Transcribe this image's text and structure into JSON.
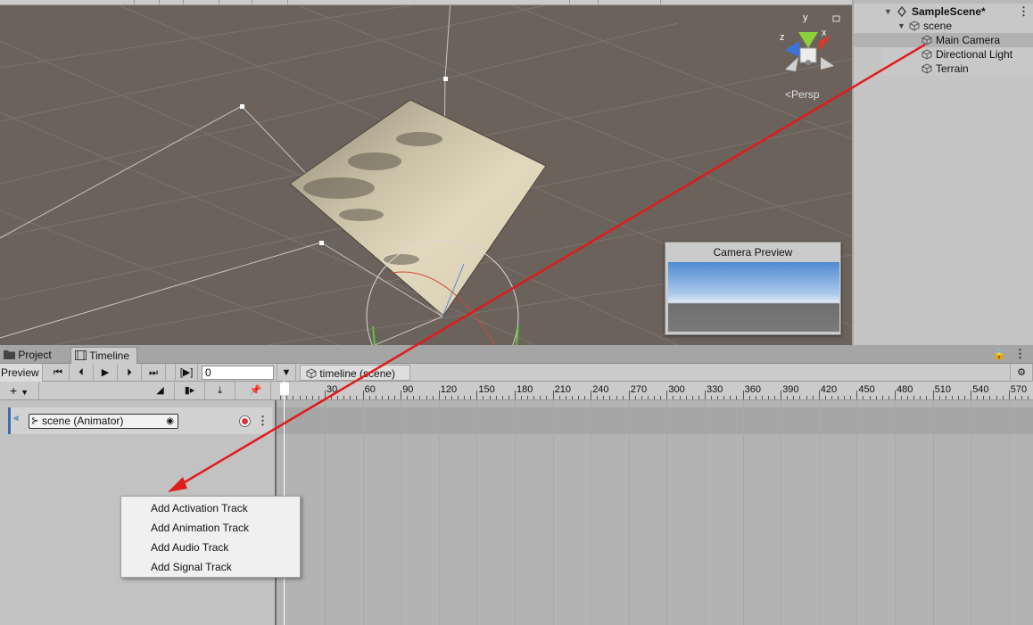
{
  "scene_view": {
    "persp_label": "Persp",
    "gizmo_axes": {
      "x": "x",
      "y": "y",
      "z": "z"
    },
    "camera_preview_title": "Camera Preview"
  },
  "hierarchy": {
    "scene_name": "SampleScene*",
    "items": [
      {
        "label": "scene"
      },
      {
        "label": "Main Camera"
      },
      {
        "label": "Directional Light"
      },
      {
        "label": "Terrain"
      }
    ]
  },
  "timeline_window": {
    "tabs": [
      {
        "label": "Project"
      },
      {
        "label": "Timeline"
      }
    ],
    "preview_label": "Preview",
    "frame_value": "0",
    "breadcrumb": "timeline (scene)",
    "ruler_ticks": [
      "30",
      "60",
      "90",
      "120",
      "150",
      "180",
      "210",
      "240",
      "270",
      "300",
      "330",
      "360",
      "390",
      "420",
      "450",
      "480",
      "510",
      "540",
      "570"
    ],
    "track": {
      "label": "scene (Animator)"
    }
  },
  "context_menu": {
    "items": [
      {
        "label": "Add Activation Track"
      },
      {
        "label": "Add Animation Track"
      },
      {
        "label": "Add Audio Track"
      },
      {
        "label": "Add Signal Track"
      }
    ]
  },
  "colors": {
    "annotation_arrow": "#e01b1b",
    "track_accent": "#3a6db1",
    "record": "#e0313a"
  }
}
